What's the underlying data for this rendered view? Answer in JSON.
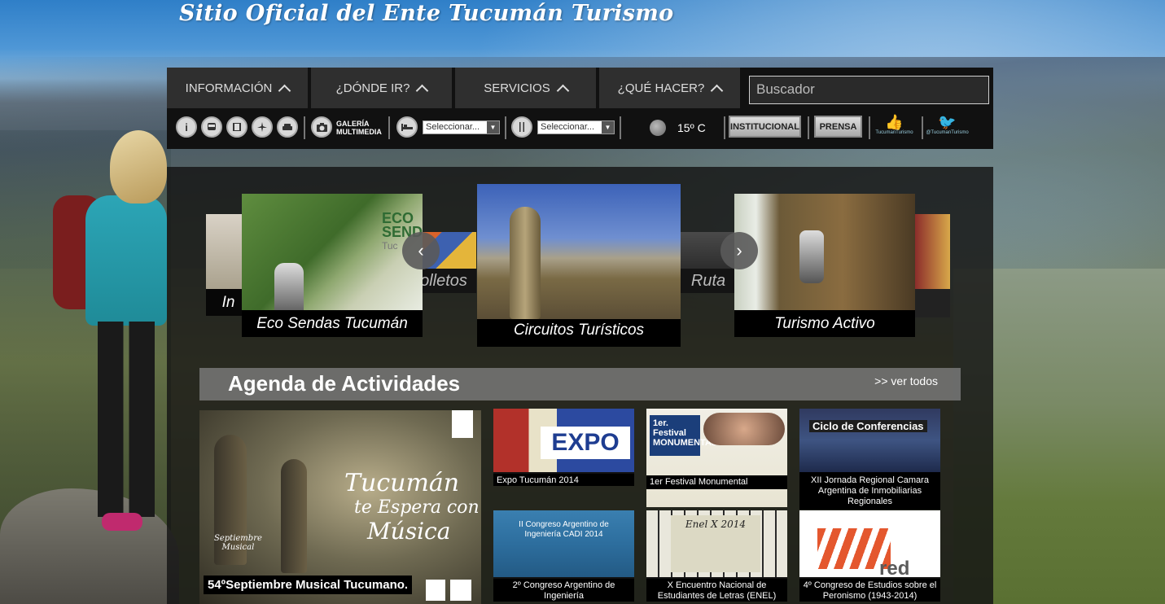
{
  "site": {
    "title": "Sitio Oficial del Ente Tucumán Turismo"
  },
  "nav": {
    "menu": [
      {
        "label": "INFORMACIÓN"
      },
      {
        "label": "¿DÓNDE IR?"
      },
      {
        "label": "SERVICIOS"
      },
      {
        "label": "¿QUÉ HACER?"
      }
    ],
    "search_placeholder": "Buscador",
    "toolbar": {
      "info_icon": "i",
      "galeria_line1": "GALERÍA",
      "galeria_line2": "MULTIMEDIA",
      "select1": "Seleccionar...",
      "select2": "Seleccionar...",
      "temperature": "15º C",
      "institucional": "INSTITUCIONAL",
      "prensa": "PRENSA",
      "facebook_label": "TucumanTurismo",
      "twitter_label": "@TucumanTurismo"
    }
  },
  "carousel": {
    "back_left": "In",
    "back_folletos": "olletos",
    "back_ruta": "Ruta de",
    "items": [
      {
        "caption": "Eco Sendas Tucumán",
        "logo_line1": "ECO",
        "logo_line2": "SEND",
        "logo_line3": "Tuc"
      },
      {
        "caption": "Circuitos Turísticos"
      },
      {
        "caption": "Turismo Activo"
      }
    ]
  },
  "agenda": {
    "title": "Agenda de Actividades",
    "ver_todos": ">> ver todos",
    "featured": {
      "caption": "54ºSeptiembre Musical Tucumano.",
      "art_line1": "Tucumán",
      "art_line2": "te Espera con",
      "art_line3": "Música",
      "badge_line1": "Septiembre",
      "badge_line2": "Musical"
    },
    "tiles": [
      {
        "label": "Expo Tucumán 2014",
        "art": "EXPO"
      },
      {
        "label": "1er Festival Monumental",
        "art": "1er. Festival MONUMENTAL"
      },
      {
        "label": "XII Jornada Regional Camara Argentina de Inmobiliarias Regionales",
        "art": "Ciclo de Conferencias"
      },
      {
        "label": "2º Congreso Argentino de Ingeniería",
        "art": "II Congreso Argentino de Ingeniería CADI 2014"
      },
      {
        "label": "X Encuentro Nacional de Estudiantes de Letras (ENEL)",
        "art": "Enel X 2014"
      },
      {
        "label": "4º Congreso de Estudios sobre el Peronismo (1943-2014)",
        "art": "red"
      }
    ]
  }
}
